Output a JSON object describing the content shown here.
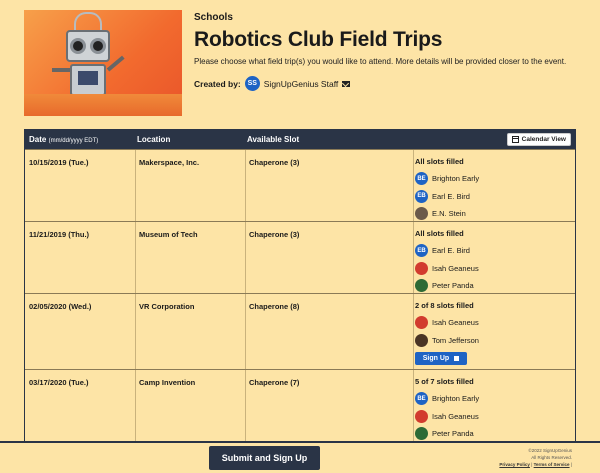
{
  "header": {
    "category": "Schools",
    "title": "Robotics Club Field Trips",
    "description": "Please choose what field trip(s) you would like to attend. More details will be provided closer to the event.",
    "created_by_label": "Created by:",
    "creator_initials": "SS",
    "creator_name": "SignUpGenius Staff",
    "hero_icon": "robot-image"
  },
  "table": {
    "headers": {
      "date": "Date",
      "date_format": "(mm/dd/yyyy EDT)",
      "location": "Location",
      "slot": "Available Slot",
      "calendar_button": "Calendar View"
    },
    "rows": [
      {
        "date": "10/15/2019 (Tue.)",
        "location": "Makerspace, Inc.",
        "slot": "Chaperone (3)",
        "status": "All slots filled",
        "people": [
          {
            "initials": "BE",
            "name": "Brighton Early",
            "avatar": "blue"
          },
          {
            "initials": "EB",
            "name": "Earl E. Bird",
            "avatar": "blue"
          },
          {
            "initials": "",
            "name": "E.N. Stein",
            "avatar": "photo"
          }
        ]
      },
      {
        "date": "11/21/2019 (Thu.)",
        "location": "Museum of Tech",
        "slot": "Chaperone (3)",
        "status": "All slots filled",
        "people": [
          {
            "initials": "EB",
            "name": "Earl E. Bird",
            "avatar": "blue"
          },
          {
            "initials": "",
            "name": "Isah Geaneus",
            "avatar": "apple"
          },
          {
            "initials": "",
            "name": "Peter Panda",
            "avatar": "green"
          }
        ]
      },
      {
        "date": "02/05/2020 (Wed.)",
        "location": "VR Corporation",
        "slot": "Chaperone (8)",
        "status": "2 of 8 slots filled",
        "people": [
          {
            "initials": "",
            "name": "Isah Geaneus",
            "avatar": "apple"
          },
          {
            "initials": "",
            "name": "Tom Jefferson",
            "avatar": "dark"
          }
        ],
        "signup_label": "Sign Up"
      },
      {
        "date": "03/17/2020 (Tue.)",
        "location": "Camp Invention",
        "slot": "Chaperone (7)",
        "status": "5 of 7 slots filled",
        "people": [
          {
            "initials": "BE",
            "name": "Brighton Early",
            "avatar": "blue"
          },
          {
            "initials": "",
            "name": "Isah Geaneus",
            "avatar": "apple"
          },
          {
            "initials": "",
            "name": "Peter Panda",
            "avatar": "green"
          },
          {
            "initials": "",
            "name": "",
            "avatar": "blue"
          }
        ]
      }
    ]
  },
  "footer": {
    "submit_label": "Submit and Sign Up",
    "copyright": "©2022 SignUpGenius",
    "rights": "All Rights Reserved.",
    "privacy": "Privacy Policy",
    "separator": "|",
    "terms": "Terms of Service",
    "terms_suffix": "|"
  },
  "colors": {
    "background": "#fde4a6",
    "header_bar": "#2a3446",
    "accent": "#1e63c4"
  }
}
